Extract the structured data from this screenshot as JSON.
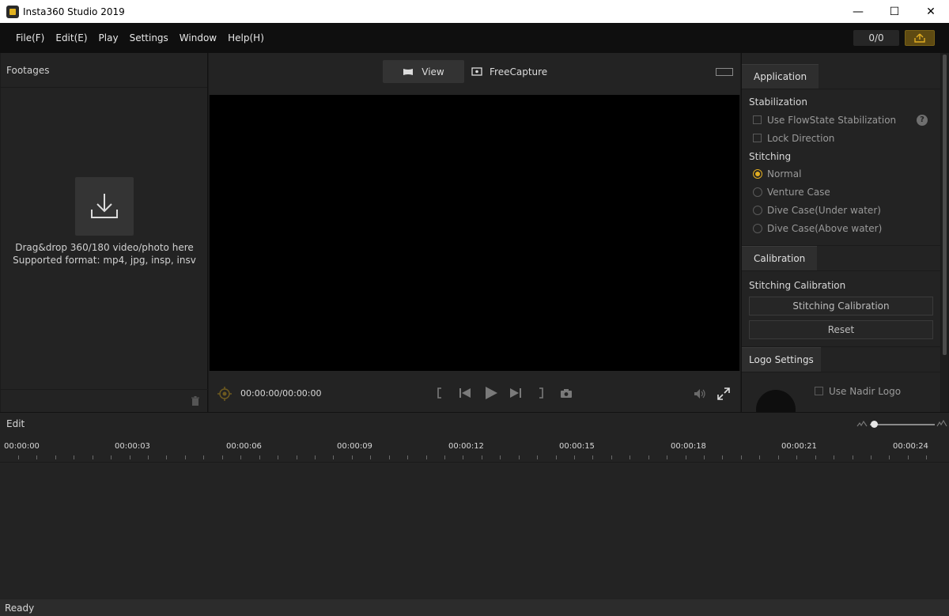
{
  "window": {
    "title": "Insta360 Studio 2019",
    "minimize": "—",
    "maximize": "☐",
    "close": "✕"
  },
  "menu": {
    "items": [
      "File(F)",
      "Edit(E)",
      "Play",
      "Settings",
      "Window",
      "Help(H)"
    ],
    "counter": "0/0"
  },
  "footages": {
    "title": "Footages",
    "drop_line1": "Drag&drop 360/180 video/photo here",
    "drop_line2": "Supported format: mp4, jpg, insp, insv"
  },
  "viewer": {
    "tabs": [
      "View",
      "FreeCapture"
    ],
    "timecode": "00:00:00/00:00:00"
  },
  "right_panel": {
    "application_tab": "Application",
    "stabilization_label": "Stabilization",
    "use_flowstate": "Use FlowState Stabilization",
    "lock_direction": "Lock Direction",
    "help": "?",
    "stitching_label": "Stitching",
    "stitching_options": [
      "Normal",
      "Venture Case",
      "Dive Case(Under water)",
      "Dive Case(Above water)"
    ],
    "calibration_tab": "Calibration",
    "stitching_calibration_label": "Stitching Calibration",
    "stitching_calibration_button": "Stitching Calibration",
    "reset_button": "Reset",
    "logo_settings_tab": "Logo Settings",
    "use_nadir_logo": "Use Nadir Logo"
  },
  "edit": {
    "title": "Edit",
    "ruler_labels": [
      "00:00:00",
      "00:00:03",
      "00:00:06",
      "00:00:09",
      "00:00:12",
      "00:00:15",
      "00:00:18",
      "00:00:21",
      "00:00:24"
    ]
  },
  "status": {
    "text": "Ready"
  },
  "colors": {
    "accent": "#e1ad22",
    "background": "#232323",
    "video": "#000000"
  }
}
